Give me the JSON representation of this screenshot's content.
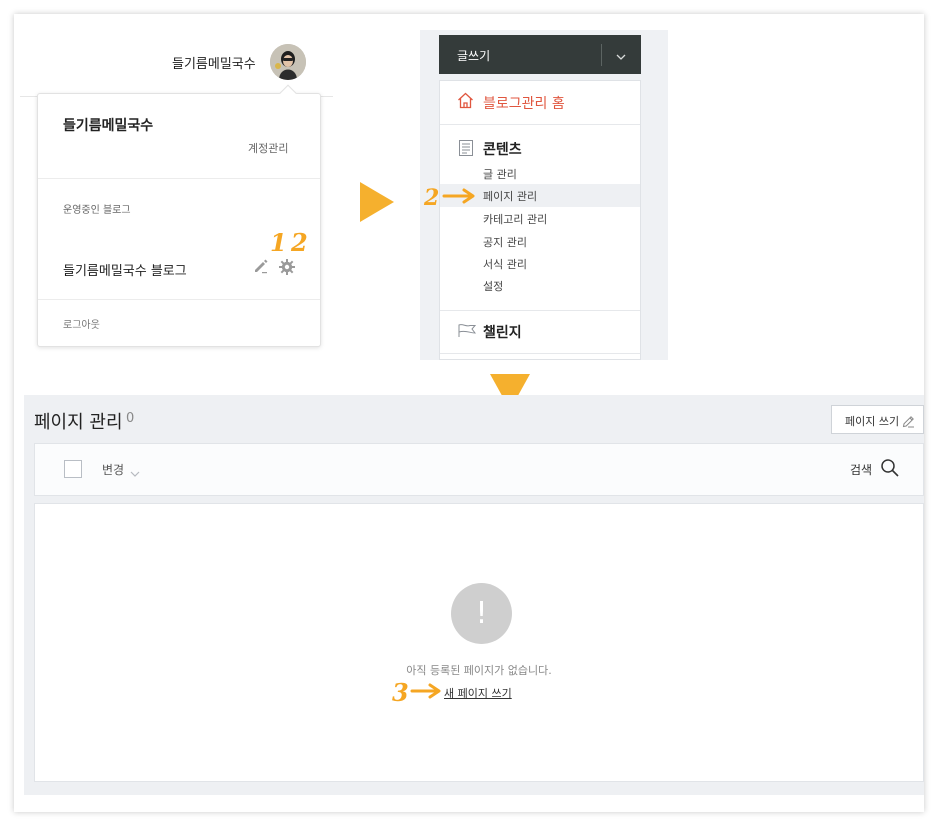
{
  "account": {
    "profile_name": "들기름메밀국수",
    "dropdown_name": "들기름메밀국수",
    "account_manage": "계정관리",
    "running_blogs_label": "운영중인 블로그",
    "blog_name": "들기름메밀국수 블로그",
    "logout": "로그아웃"
  },
  "sidebar": {
    "write_label": "글쓰기",
    "home_label": "블로그관리 홈",
    "contents_label": "콘텐츠",
    "items": [
      {
        "label": "글 관리"
      },
      {
        "label": "페이지 관리"
      },
      {
        "label": "카테고리 관리"
      },
      {
        "label": "공지 관리"
      },
      {
        "label": "서식 관리"
      },
      {
        "label": "설정"
      }
    ],
    "challenge_label": "챌린지"
  },
  "page_manage": {
    "title": "페이지 관리",
    "count": "0",
    "write_page_button": "페이지 쓰기",
    "toolbar": {
      "change_label": "변경",
      "search_label": "검색"
    },
    "empty_icon": "!",
    "empty_message": "아직 등록된 페이지가 없습니다.",
    "new_page_link": "새 페이지 쓰기"
  },
  "annotations": {
    "step1_2": "1 2",
    "step2": "2",
    "step3": "3"
  },
  "colors": {
    "accent_orange": "#f5a623",
    "home_red": "#e0563f",
    "write_button_bg": "#343b3a"
  },
  "icons": [
    "pencil-icon",
    "gear-icon",
    "home-icon",
    "document-icon",
    "flag-icon",
    "chevron-down-icon",
    "search-icon",
    "exclamation-icon"
  ]
}
